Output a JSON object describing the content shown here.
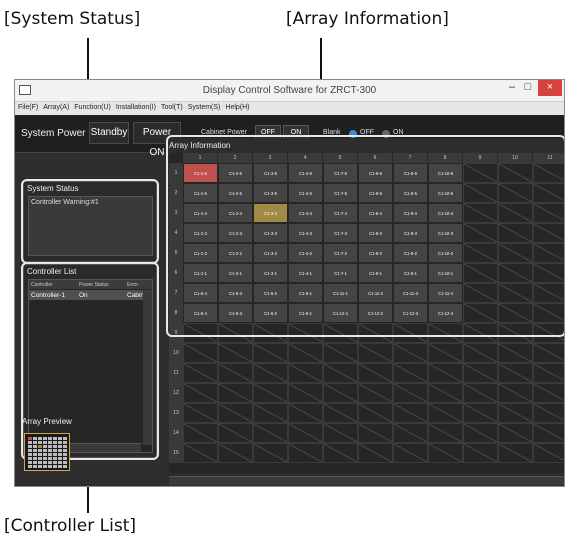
{
  "callouts": {
    "system_status": "[System Status]",
    "array_information": "[Array Information]",
    "controller_list": "[Controller List]"
  },
  "window": {
    "title": "Display Control Software for ZRCT-300"
  },
  "menu": [
    "File(F)",
    "Array(A)",
    "Function(U)",
    "Installation(I)",
    "Tool(T)",
    "System(S)",
    "Help(H)"
  ],
  "toolbar": {
    "system_power_label": "System Power",
    "standby_label": "Standby",
    "power_on_label": "Power ON",
    "cabinet_power_label": "Cabinet Power",
    "cabinet_off": "OFF",
    "cabinet_on": "ON",
    "blank_label": "Blank",
    "blank_off": "OFF",
    "blank_on": "ON",
    "blank_selected": "OFF"
  },
  "system_status": {
    "title": "System Status",
    "message": "Controller Warning:#1"
  },
  "controller_list": {
    "title": "Controller List",
    "columns": [
      "Controller",
      "Power Status",
      "Error"
    ],
    "rows": [
      [
        "Controller-1",
        "On",
        "Cabinet"
      ]
    ]
  },
  "array_preview": {
    "title": "Array Preview"
  },
  "array_information": {
    "title": "Array Information",
    "columns": [
      "1",
      "2",
      "3",
      "4",
      "5",
      "6",
      "7",
      "8",
      "9",
      "10",
      "11"
    ],
    "rows": [
      "1",
      "2",
      "3",
      "4",
      "5",
      "6",
      "7",
      "8",
      "9",
      "10",
      "11",
      "12",
      "13",
      "14",
      "15"
    ],
    "cells": [
      [
        "C1-1-6",
        "C1-2-6",
        "C1-3-6",
        "C1-4-6",
        "C1-7-6",
        "C1-8-6",
        "C1-9-6",
        "C1-10-6"
      ],
      [
        "C1-1-5",
        "C1-2-5",
        "C1-3-5",
        "C1-4-5",
        "C1-7-5",
        "C1-8-5",
        "C1-9-5",
        "C1-10-5"
      ],
      [
        "C1-1-4",
        "C1-2-4",
        "C1-3-4",
        "C1-4-4",
        "C1-7-4",
        "C1-8-4",
        "C1-9-4",
        "C1-10-4"
      ],
      [
        "C1-1-3",
        "C1-2-3",
        "C1-3-3",
        "C1-4-3",
        "C1-7-3",
        "C1-8-3",
        "C1-9-3",
        "C1-10-3"
      ],
      [
        "C1-1-2",
        "C1-2-2",
        "C1-3-2",
        "C1-4-2",
        "C1-7-2",
        "C1-8-2",
        "C1-9-2",
        "C1-10-2"
      ],
      [
        "C1-1-1",
        "C1-2-1",
        "C1-3-1",
        "C1-4-1",
        "C1-7-1",
        "C1-8-1",
        "C1-9-1",
        "C1-10-1"
      ],
      [
        "C1-6-4",
        "C1-6-3",
        "C1-6-2",
        "C1-6-1",
        "C1-11-1",
        "C1-11-2",
        "C1-11-3",
        "C1-11-4"
      ],
      [
        "C1-6-4",
        "C1-6-3",
        "C1-6-2",
        "C1-6-1",
        "C1-12-1",
        "C1-12-2",
        "C1-12-3",
        "C1-12-4"
      ]
    ],
    "error_cell": "C1-1-6",
    "selected_cell": "C1-3-4",
    "colors": {
      "error": "#c0504d",
      "selected": "#a08a45",
      "normal": "#444444"
    }
  }
}
